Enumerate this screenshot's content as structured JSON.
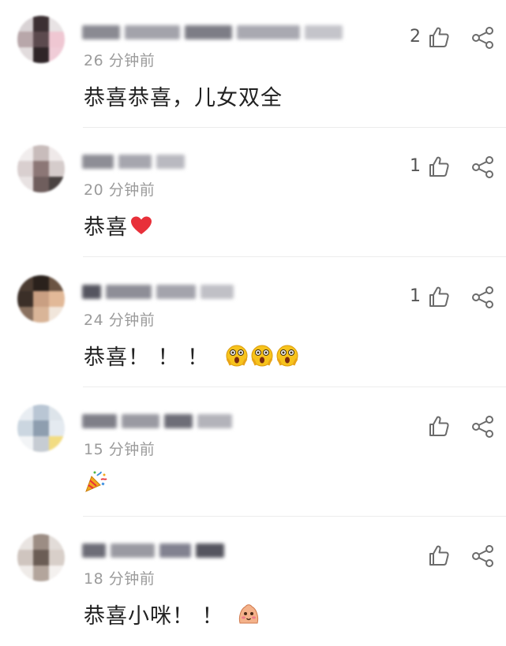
{
  "comments": [
    {
      "username": "",
      "time": "26 分钟前",
      "text": "恭喜恭喜，儿女双全",
      "likes": "2",
      "emojis": []
    },
    {
      "username": "",
      "time": "20 分钟前",
      "text": "恭喜",
      "likes": "1",
      "emojis": [
        "red-heart"
      ]
    },
    {
      "username": "",
      "time": "24 分钟前",
      "text": "恭喜！ ！ ！",
      "likes": "1",
      "emojis": [
        "shocked-face",
        "shocked-face",
        "shocked-face"
      ]
    },
    {
      "username": "",
      "time": "15 分钟前",
      "text": "",
      "likes": "",
      "emojis": [
        "party-popper"
      ]
    },
    {
      "username": "",
      "time": "18 分钟前",
      "text": "恭喜小咪！ ！",
      "likes": "",
      "emojis": [
        "blush-face"
      ]
    }
  ],
  "colors": {
    "text": "#222222",
    "time": "#9b9b9b",
    "icon": "#6b6b6b",
    "heart": "#e8303a"
  }
}
